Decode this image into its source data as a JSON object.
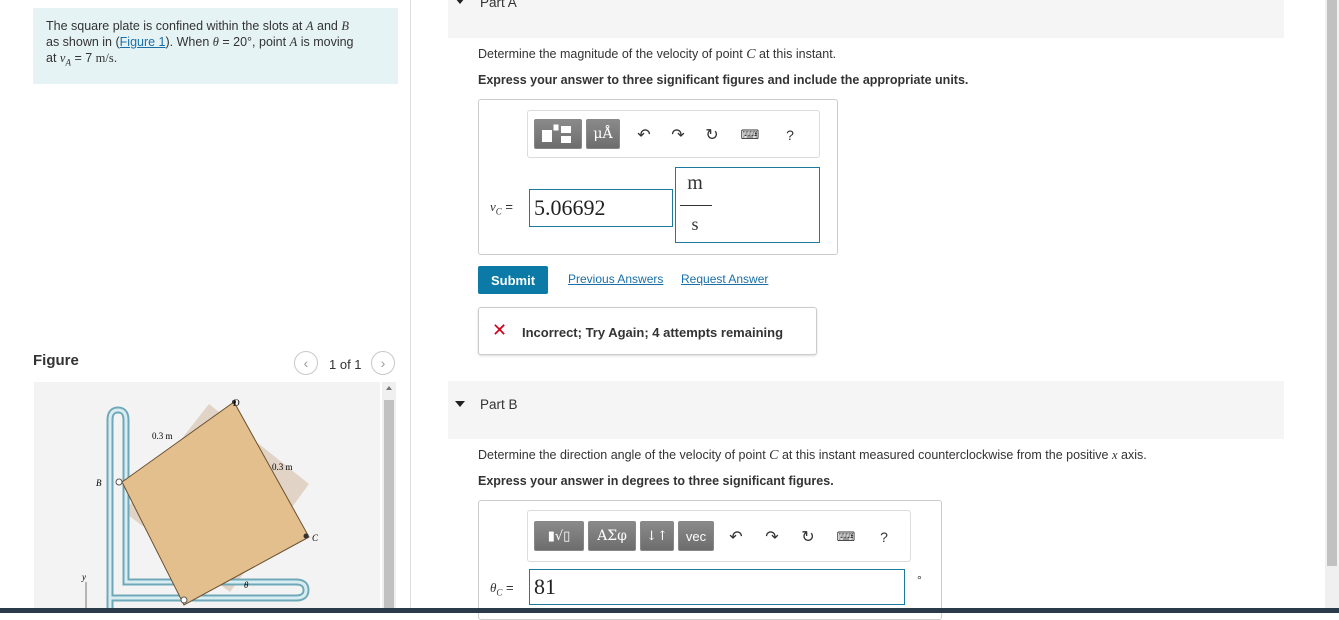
{
  "problem": {
    "text_1": "The square plate is confined within the slots at ",
    "var_A": "A",
    "text_and": " and ",
    "var_B": "B",
    "text_2": "as shown in (",
    "figure_link": "Figure 1",
    "text_3": "). When ",
    "theta": "θ",
    "text_4": " = 20°, point ",
    "var_A2": "A",
    "text_5": " is moving",
    "text_6": "at ",
    "vA": "v",
    "vA_sub": "A",
    "text_7": " = 7 ",
    "unit": "m/s",
    "text_8": "."
  },
  "figure": {
    "label": "Figure",
    "count": "1 of 1",
    "prev_icon": "chevron-left-icon",
    "next_icon": "chevron-right-icon",
    "labels": {
      "D": "D",
      "B": "B",
      "C": "C",
      "theta": "θ",
      "y": "y",
      "dim1": "0.3 m",
      "dim2": "0.3 m"
    },
    "plate_color": "#e2bf8c"
  },
  "partA": {
    "title": "Part A",
    "question": "Determine the magnitude of the velocity of point ",
    "question_var": "C",
    "question_end": " at this instant.",
    "instruction": "Express your answer to three significant figures and include the appropriate units.",
    "toolbar": {
      "template_icon": "template-icon",
      "units_label": "μÅ",
      "undo_icon": "undo-icon",
      "redo_icon": "redo-icon",
      "reset_icon": "reset-icon",
      "keyboard_icon": "keyboard-icon",
      "help_label": "?"
    },
    "var_label": "v",
    "var_sub": "C",
    "equals": "=",
    "value": "5.06692",
    "unit_num": "m",
    "unit_den": "s",
    "submit": "Submit",
    "prev_answers": "Previous Answers",
    "request_answer": "Request Answer",
    "feedback": "Incorrect; Try Again; 4 attempts remaining",
    "feedback_icon": "x-icon",
    "feedback_color": "#d0021b"
  },
  "partB": {
    "title": "Part B",
    "question": "Determine the direction angle of the velocity of point ",
    "question_var": "C",
    "question_mid": " at this instant measured counterclockwise from the positive ",
    "question_axis": "x",
    "question_end": " axis.",
    "instruction": "Express your answer in degrees to three significant figures.",
    "toolbar": {
      "template_icon": "sqrt-template-icon",
      "greek_label": "ΑΣφ",
      "arrows_label": "↓↑",
      "vec_label": "vec",
      "undo_icon": "undo-icon",
      "redo_icon": "redo-icon",
      "reset_icon": "reset-icon",
      "keyboard_icon": "keyboard-icon",
      "help_label": "?"
    },
    "var_label": "θ",
    "var_sub": "C",
    "equals": "=",
    "value": "81",
    "unit": "°"
  },
  "colors": {
    "accent": "#0b7aa6",
    "problem_bg": "#e6f3f5",
    "input_border": "#1c7a9c"
  }
}
